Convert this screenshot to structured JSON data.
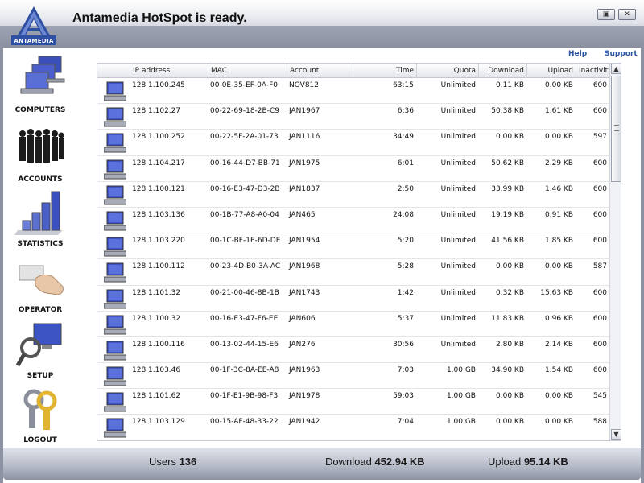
{
  "app": {
    "title": "Antamedia HotSpot is ready.",
    "logo_text": "ANTAMEDIA"
  },
  "window_controls": {
    "restore": "▣",
    "close": "✕"
  },
  "links": {
    "help": "Help",
    "support": "Support"
  },
  "nav": [
    {
      "label": "COMPUTERS",
      "icon": "computers-icon"
    },
    {
      "label": "ACCOUNTS",
      "icon": "accounts-icon"
    },
    {
      "label": "STATISTICS",
      "icon": "statistics-icon"
    },
    {
      "label": "OPERATOR",
      "icon": "operator-icon"
    },
    {
      "label": "SETUP",
      "icon": "setup-icon"
    },
    {
      "label": "LOGOUT",
      "icon": "logout-icon"
    }
  ],
  "table": {
    "columns": [
      "IP address",
      "MAC",
      "Account",
      "Time",
      "Quota",
      "Download",
      "Upload",
      "Inactivity"
    ],
    "rows": [
      [
        "128.1.100.245",
        "00-0E-35-EF-0A-F0",
        "NOV812",
        "63:15",
        "Unlimited",
        "0.11 KB",
        "0.00 KB",
        "600"
      ],
      [
        "128.1.102.27",
        "00-22-69-18-2B-C9",
        "JAN1967",
        "6:36",
        "Unlimited",
        "50.38 KB",
        "1.61 KB",
        "600"
      ],
      [
        "128.1.100.252",
        "00-22-5F-2A-01-73",
        "JAN1116",
        "34:49",
        "Unlimited",
        "0.00 KB",
        "0.00 KB",
        "597"
      ],
      [
        "128.1.104.217",
        "00-16-44-D7-BB-71",
        "JAN1975",
        "6:01",
        "Unlimited",
        "50.62 KB",
        "2.29 KB",
        "600"
      ],
      [
        "128.1.100.121",
        "00-16-E3-47-D3-2B",
        "JAN1837",
        "2:50",
        "Unlimited",
        "33.99 KB",
        "1.46 KB",
        "600"
      ],
      [
        "128.1.103.136",
        "00-1B-77-A8-A0-04",
        "JAN465",
        "24:08",
        "Unlimited",
        "19.19 KB",
        "0.91 KB",
        "600"
      ],
      [
        "128.1.103.220",
        "00-1C-BF-1E-6D-DE",
        "JAN1954",
        "5:20",
        "Unlimited",
        "41.56 KB",
        "1.85 KB",
        "600"
      ],
      [
        "128.1.100.112",
        "00-23-4D-B0-3A-AC",
        "JAN1968",
        "5:28",
        "Unlimited",
        "0.00 KB",
        "0.00 KB",
        "587"
      ],
      [
        "128.1.101.32",
        "00-21-00-46-8B-1B",
        "JAN1743",
        "1:42",
        "Unlimited",
        "0.32 KB",
        "15.63 KB",
        "600"
      ],
      [
        "128.1.100.32",
        "00-16-E3-47-F6-EE",
        "JAN606",
        "5:37",
        "Unlimited",
        "11.83 KB",
        "0.96 KB",
        "600"
      ],
      [
        "128.1.100.116",
        "00-13-02-44-15-E6",
        "JAN276",
        "30:56",
        "Unlimited",
        "2.80 KB",
        "2.14 KB",
        "600"
      ],
      [
        "128.1.103.46",
        "00-1F-3C-8A-EE-A8",
        "JAN1963",
        "7:03",
        "1.00 GB",
        "34.90 KB",
        "1.54 KB",
        "600"
      ],
      [
        "128.1.101.62",
        "00-1F-E1-9B-98-F3",
        "JAN1978",
        "59:03",
        "1.00 GB",
        "0.00 KB",
        "0.00 KB",
        "545"
      ],
      [
        "128.1.103.129",
        "00-15-AF-48-33-22",
        "JAN1942",
        "7:04",
        "1.00 GB",
        "0.00 KB",
        "0.00 KB",
        "588"
      ]
    ]
  },
  "scrollbar": {
    "up": "▲",
    "down": "▼"
  },
  "status": {
    "users_label": "Users",
    "users_value": "136",
    "download_label": "Download",
    "download_value": "452.94 KB",
    "upload_label": "Upload",
    "upload_value": "95.14 KB"
  }
}
